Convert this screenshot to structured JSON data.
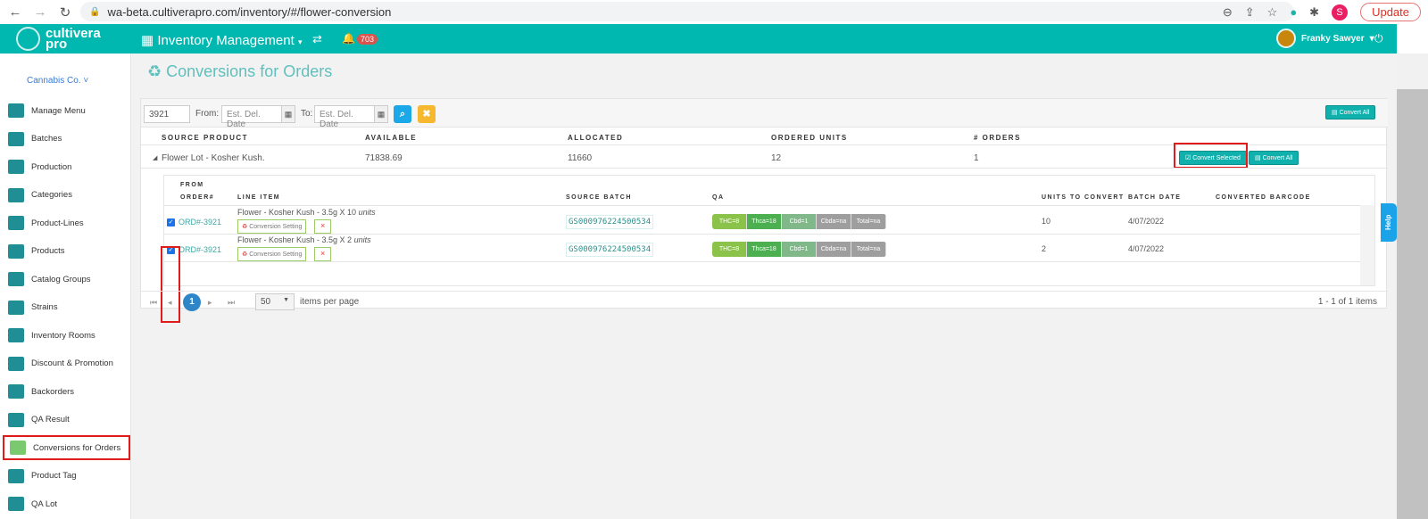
{
  "browser": {
    "url": "wa-beta.cultiverapro.com/inventory/#/flower-conversion",
    "update_label": "Update",
    "profile_initial": "S"
  },
  "header": {
    "logo_line1": "cultivera",
    "logo_line2": "pro",
    "module": "Inventory Management",
    "notifications": "703",
    "user": "Franky Sawyer"
  },
  "sidebar": {
    "company": "Cannabis Co.",
    "items": [
      {
        "label": "Manage Menu"
      },
      {
        "label": "Batches"
      },
      {
        "label": "Production"
      },
      {
        "label": "Categories"
      },
      {
        "label": "Product-Lines"
      },
      {
        "label": "Products"
      },
      {
        "label": "Catalog Groups"
      },
      {
        "label": "Strains"
      },
      {
        "label": "Inventory Rooms"
      },
      {
        "label": "Discount & Promotion"
      },
      {
        "label": "Backorders"
      },
      {
        "label": "QA Result"
      },
      {
        "label": "Conversions for Orders"
      },
      {
        "label": "Product Tag"
      },
      {
        "label": "QA Lot"
      }
    ]
  },
  "page": {
    "title": "Conversions for Orders"
  },
  "filters": {
    "order_value": "3921",
    "from_label": "From:",
    "to_label": "To:",
    "date_placeholder": "Est. Del. Date",
    "convert_all": "Convert All"
  },
  "table": {
    "headers": [
      "SOURCE PRODUCT",
      "AVAILABLE",
      "ALLOCATED",
      "ORDERED UNITS",
      "# ORDERS"
    ],
    "row": {
      "product": "Flower Lot - Kosher Kush.",
      "available": "71838.69",
      "allocated": "11660",
      "ordered": "12",
      "orders": "1",
      "convert_selected": "Convert Selected",
      "convert_all": "Convert All"
    }
  },
  "subtable": {
    "headers": {
      "from": "FROM",
      "order": "ORDER#",
      "line": "LINE ITEM",
      "batch": "SOURCE BATCH",
      "qa": "QA",
      "units": "UNITS TO CONVERT",
      "date": "BATCH DATE",
      "barcode": "CONVERTED BARCODE"
    },
    "conversion_setting": "Conversion Setting",
    "remove": "×",
    "rows": [
      {
        "order": "ORD#-3921",
        "line": "Flower - Kosher Kush - 3.5g X 10",
        "unit_word": "units",
        "batch": "GS000976224500534",
        "qa": [
          "THC=8",
          "Thca=18",
          "Cbd=1",
          "Cbda=na",
          "Total=na"
        ],
        "units": "10",
        "date": "4/07/2022",
        "checked": true
      },
      {
        "order": "ORD#-3921",
        "line": "Flower - Kosher Kush - 3.5g X 2",
        "unit_word": "units",
        "batch": "GS000976224500534",
        "qa": [
          "THC=8",
          "Thca=18",
          "Cbd=1",
          "Cbda=na",
          "Total=na"
        ],
        "units": "2",
        "date": "4/07/2022",
        "checked": true
      }
    ]
  },
  "pager": {
    "page": "1",
    "page_size": "50",
    "per_page_label": "items per page",
    "summary": "1 - 1 of 1 items"
  },
  "help": "Help",
  "colors": {
    "brand": "#00b8b0",
    "qa": [
      "#8bc34a",
      "#4caf50",
      "#81b88a",
      "#9e9e9e",
      "#9e9e9e"
    ]
  }
}
